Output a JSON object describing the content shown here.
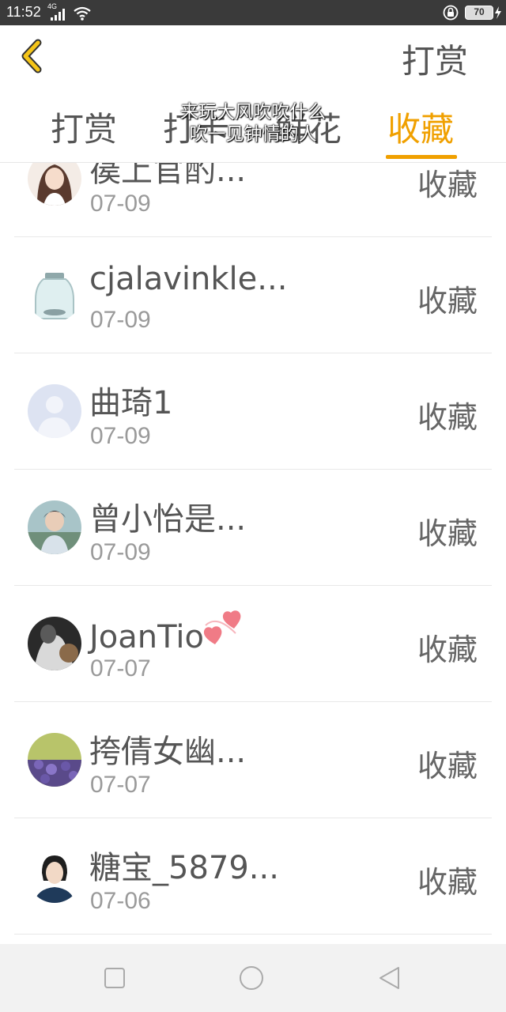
{
  "status_bar": {
    "time": "11:52",
    "network": "4G",
    "battery": "70"
  },
  "header": {
    "title": "打赏"
  },
  "tabs": [
    {
      "label": "打赏"
    },
    {
      "label": "打卡"
    },
    {
      "label": "鲜花"
    },
    {
      "label": "收藏",
      "active": true
    }
  ],
  "overlay": {
    "line1": "来玩大风吹吹什么",
    "line2": "吹一见钟情的人"
  },
  "list": {
    "items": [
      {
        "name": "篌上官酌...",
        "date": "07-09",
        "action": "收藏"
      },
      {
        "name": "cjalavinkle...",
        "date": "07-09",
        "action": "收藏"
      },
      {
        "name": "曲琦1",
        "date": "07-09",
        "action": "收藏"
      },
      {
        "name": "曾小怡是...",
        "date": "07-09",
        "action": "收藏"
      },
      {
        "name": "JoanTio",
        "date": "07-07",
        "action": "收藏"
      },
      {
        "name": "挎倩女幽...",
        "date": "07-07",
        "action": "收藏"
      },
      {
        "name": "糖宝_5879...",
        "date": "07-06",
        "action": "收藏"
      }
    ]
  },
  "colors": {
    "accent": "#f0a000",
    "status_bar": "#3a3a3a",
    "text": "#555555",
    "date_text": "#9a9a9a"
  }
}
